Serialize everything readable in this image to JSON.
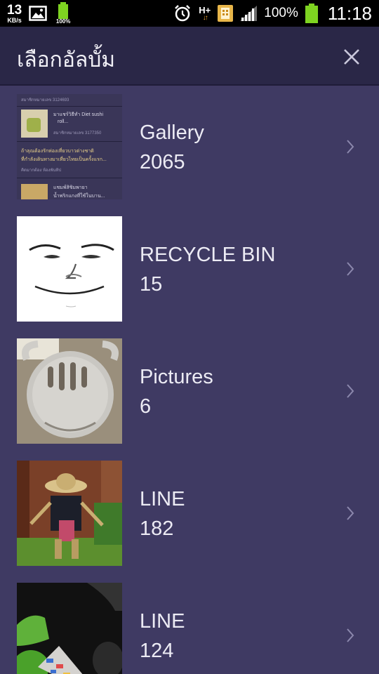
{
  "status_bar": {
    "net_speed": "13",
    "net_unit": "KB/s",
    "small_battery_pct": "100%",
    "network_type": "H+",
    "battery_pct": "100%",
    "time": "11:18",
    "icons": [
      "image-icon",
      "battery-icon",
      "alarm-icon",
      "network-hplus-icon",
      "notification-app-icon",
      "signal-icon",
      "battery-icon"
    ]
  },
  "header": {
    "title": "เลือกอัลบั้ม",
    "close_icon": "close-icon"
  },
  "albums": [
    {
      "name": "Gallery",
      "count": "2065",
      "thumbnail": "gallery-screenshot",
      "thumb_text": {
        "line0": "สมาชิกหมายเลข 3124693",
        "line1": "มาแชร์วิธีทำ Diet sushi",
        "line2": "roll...",
        "line3": "สมาชิกหมายเลข 3177350",
        "line4": "ถ้าลุณต้องรักห่องเที่ยวบาวต่างชาติ",
        "line5": "ที่กำลังเดินทางมาเที่ยวไทยเป็นครั้งแรก...",
        "line6": "คิดมากต้อง ห้องพันทิป",
        "line7": "แชมพ์สิชิมพายา",
        "line8": "น้ำพริกแกงที่ใช้ในบาน..."
      }
    },
    {
      "name": "RECYCLE BIN",
      "count": "15",
      "thumbnail": "face-drawing"
    },
    {
      "name": "Pictures",
      "count": "6",
      "thumbnail": "metal-part-photo"
    },
    {
      "name": "LINE",
      "count": "182",
      "thumbnail": "scarecrow-photo"
    },
    {
      "name": "LINE",
      "count": "124",
      "thumbnail": "desk-lamp-photo"
    }
  ],
  "colors": {
    "list_background": "#3f3a63",
    "header_background": "#2a2747",
    "status_bar_background": "#000000",
    "battery_green": "#7ed321",
    "text": "#ecebf4",
    "chevron": "#8c88ad"
  }
}
